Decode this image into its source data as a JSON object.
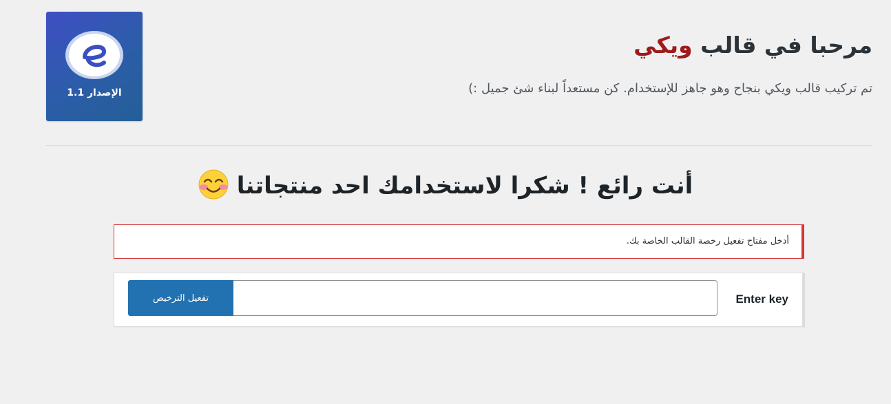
{
  "logo": {
    "icon": "theme-logo-e-icon",
    "version_label": "الإصدار 1.1",
    "gradient_start": "#3f4fc4",
    "gradient_end": "#255f96"
  },
  "header": {
    "title_prefix": "مرحبا في قالب ",
    "title_accent": "ويكي",
    "accent_color": "#9e1b1b",
    "subtitle": "تم تركيب قالب ويكي بنجاح وهو جاهز للإستخدام. كن مستعداً لبناء شئ جميل :)"
  },
  "thanks": {
    "text": "أنت رائع ! شكرا لاستخدامك احد منتجاتنا",
    "emoji_icon": "smiling-face-icon"
  },
  "notice": {
    "text": "أدخل مفتاح تفعيل رخصة القالب الخاصة بك.",
    "border_color": "#d63638"
  },
  "license": {
    "label": "Enter key",
    "input_value": "",
    "button_label": "تفعيل الترخيص",
    "button_color": "#2271b1"
  }
}
